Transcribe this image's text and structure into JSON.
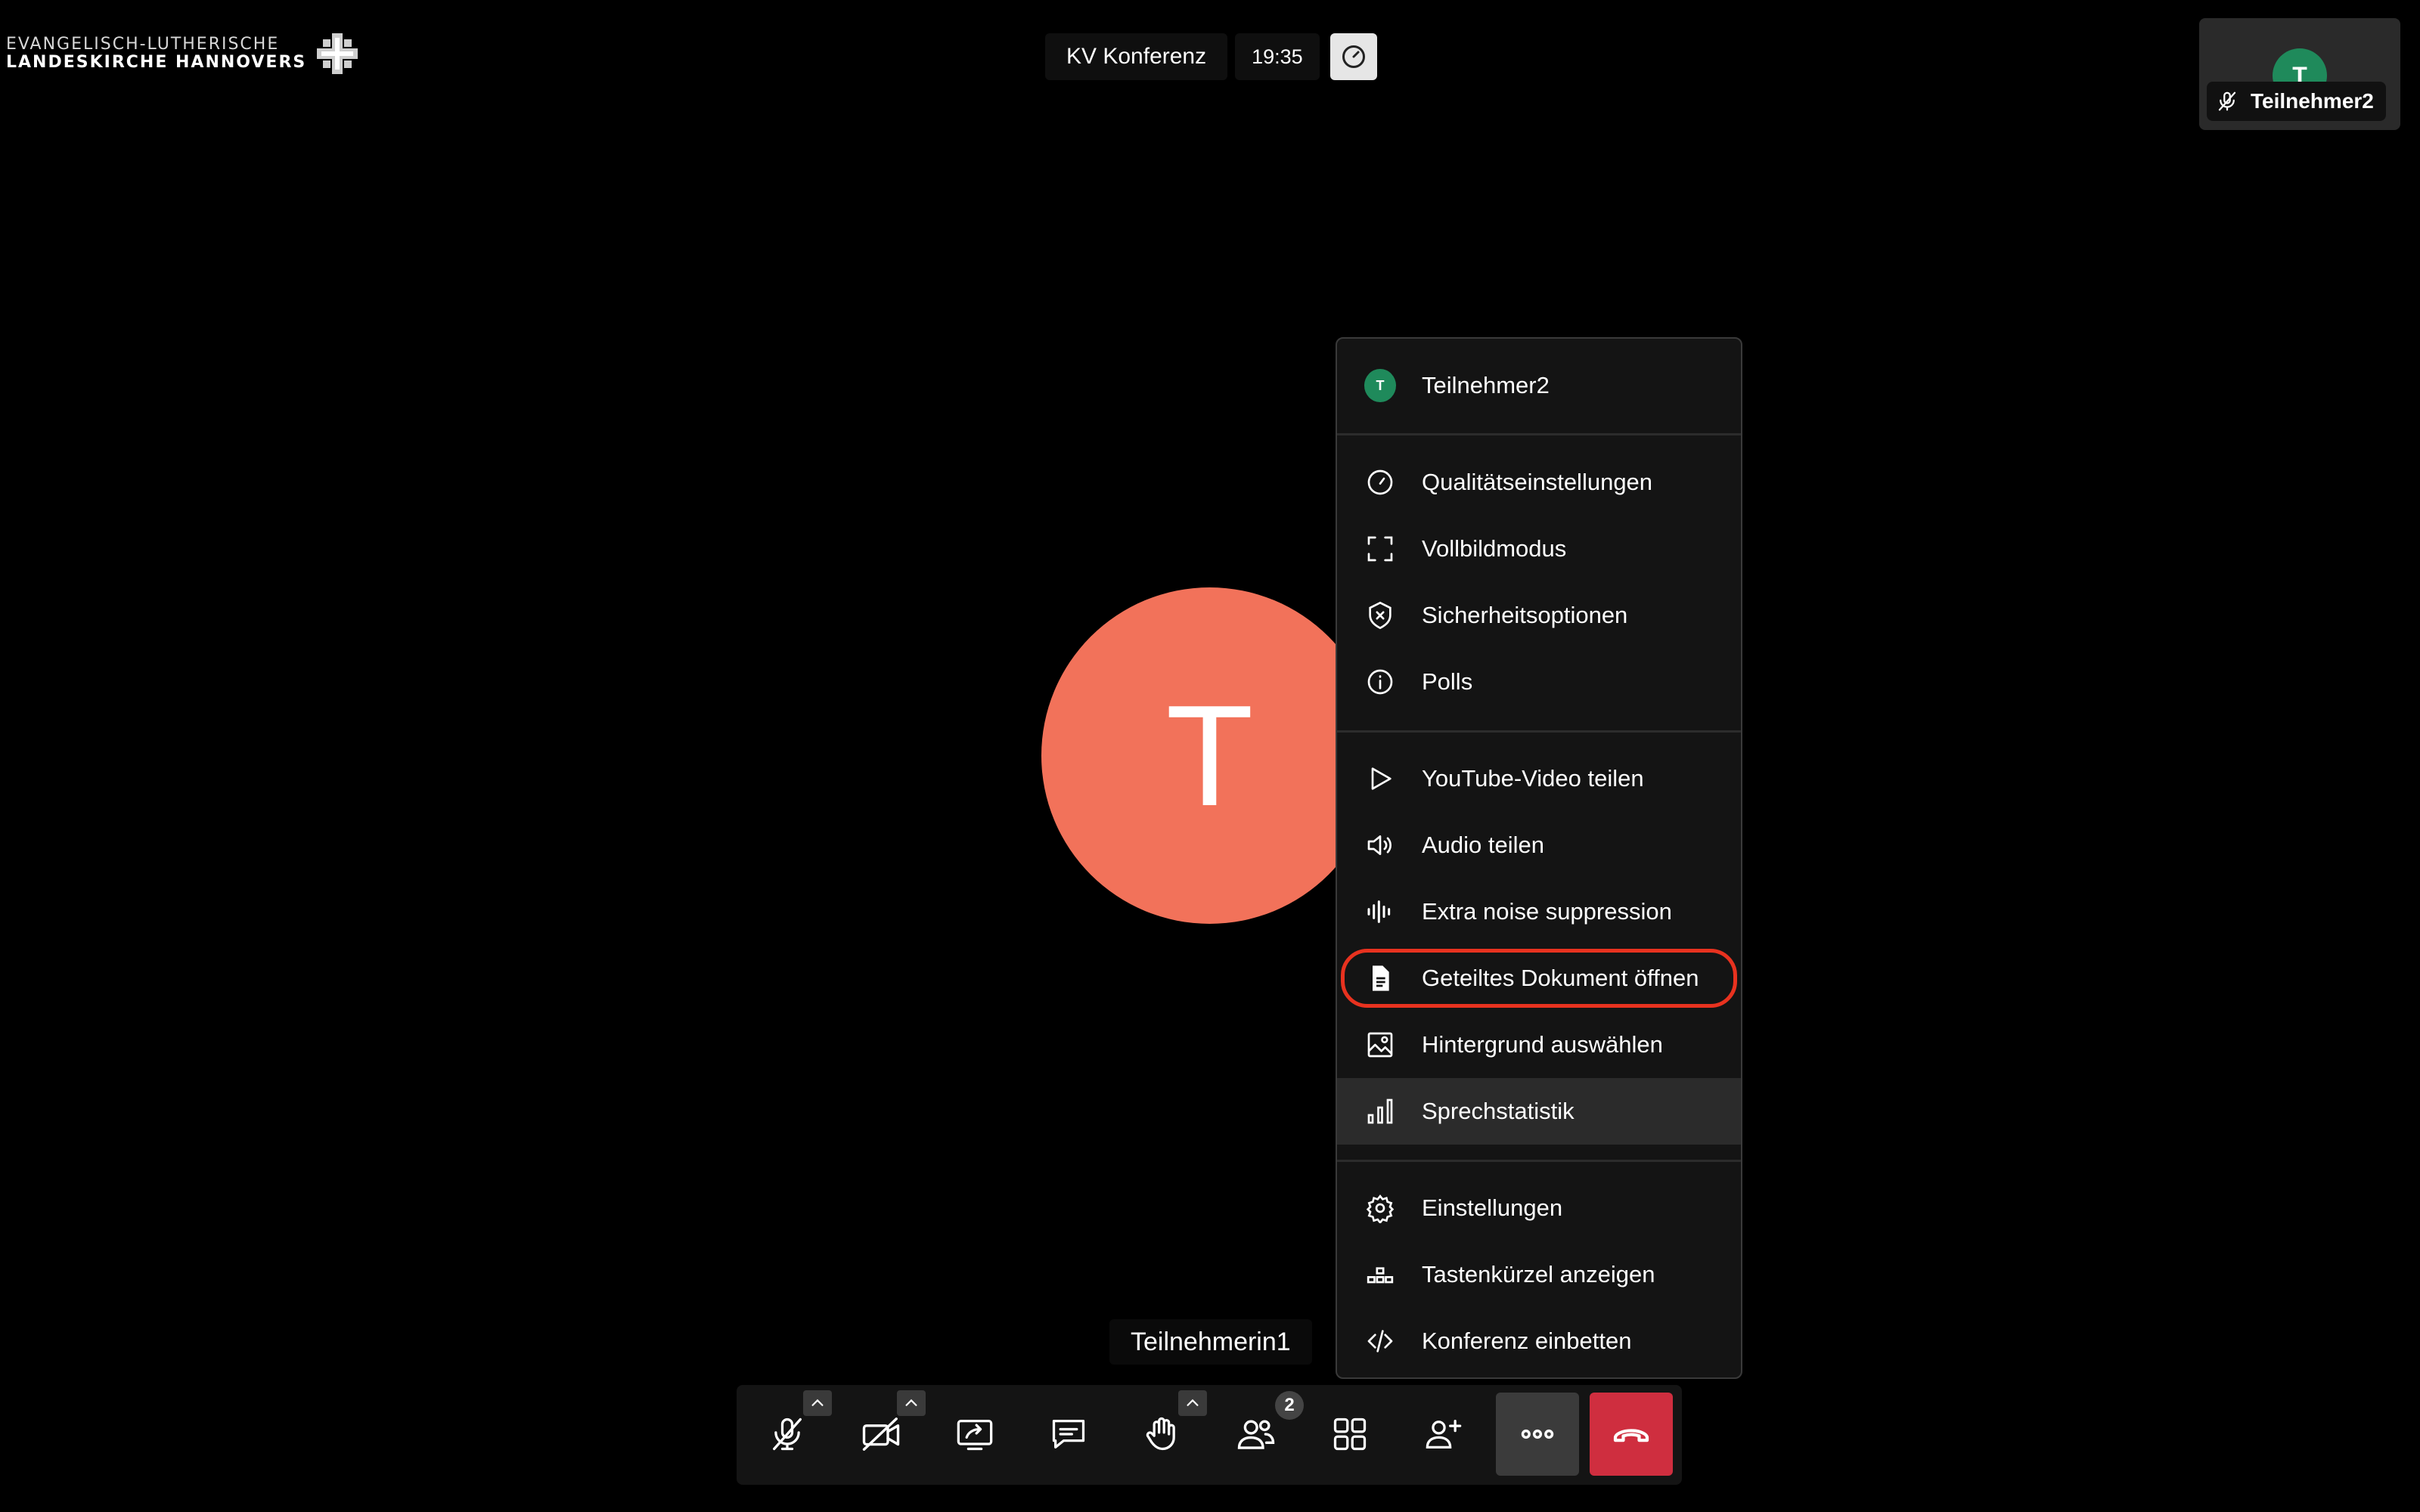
{
  "logo": {
    "line1": "EVANGELISCH-LUTHERISCHE",
    "line2": "LANDESKIRCHE HANNOVERS"
  },
  "header": {
    "title": "KV Konferenz",
    "time": "19:35"
  },
  "thumbnail": {
    "initial": "T",
    "name": "Teilnehmer2"
  },
  "main": {
    "initial": "T",
    "name_tag": "Teilnehmerin1"
  },
  "menu": {
    "participant": {
      "initial": "T",
      "name": "Teilnehmer2"
    },
    "items": [
      {
        "label": "Qualitätseinstellungen",
        "icon": "gauge-icon"
      },
      {
        "label": "Vollbildmodus",
        "icon": "fullscreen-icon"
      },
      {
        "label": "Sicherheitsoptionen",
        "icon": "shield-icon"
      },
      {
        "label": "Polls",
        "icon": "info-icon"
      },
      {
        "label": "YouTube-Video teilen",
        "icon": "play-icon"
      },
      {
        "label": "Audio teilen",
        "icon": "speaker-icon"
      },
      {
        "label": "Extra noise suppression",
        "icon": "waveform-icon"
      },
      {
        "label": "Geteiltes Dokument öffnen",
        "icon": "document-icon"
      },
      {
        "label": "Hintergrund auswählen",
        "icon": "image-icon"
      },
      {
        "label": "Sprechstatistik",
        "icon": "bar-chart-icon"
      },
      {
        "label": "Einstellungen",
        "icon": "gear-icon"
      },
      {
        "label": "Tastenkürzel anzeigen",
        "icon": "keyboard-icon"
      },
      {
        "label": "Konferenz einbetten",
        "icon": "code-icon"
      }
    ]
  },
  "toolbar": {
    "participants_count": "2"
  },
  "colors": {
    "accent_red": "#cf2e3f",
    "avatar_main": "#f2725a",
    "avatar_green": "#1f8a5b",
    "highlight_circle": "#e8321f"
  }
}
